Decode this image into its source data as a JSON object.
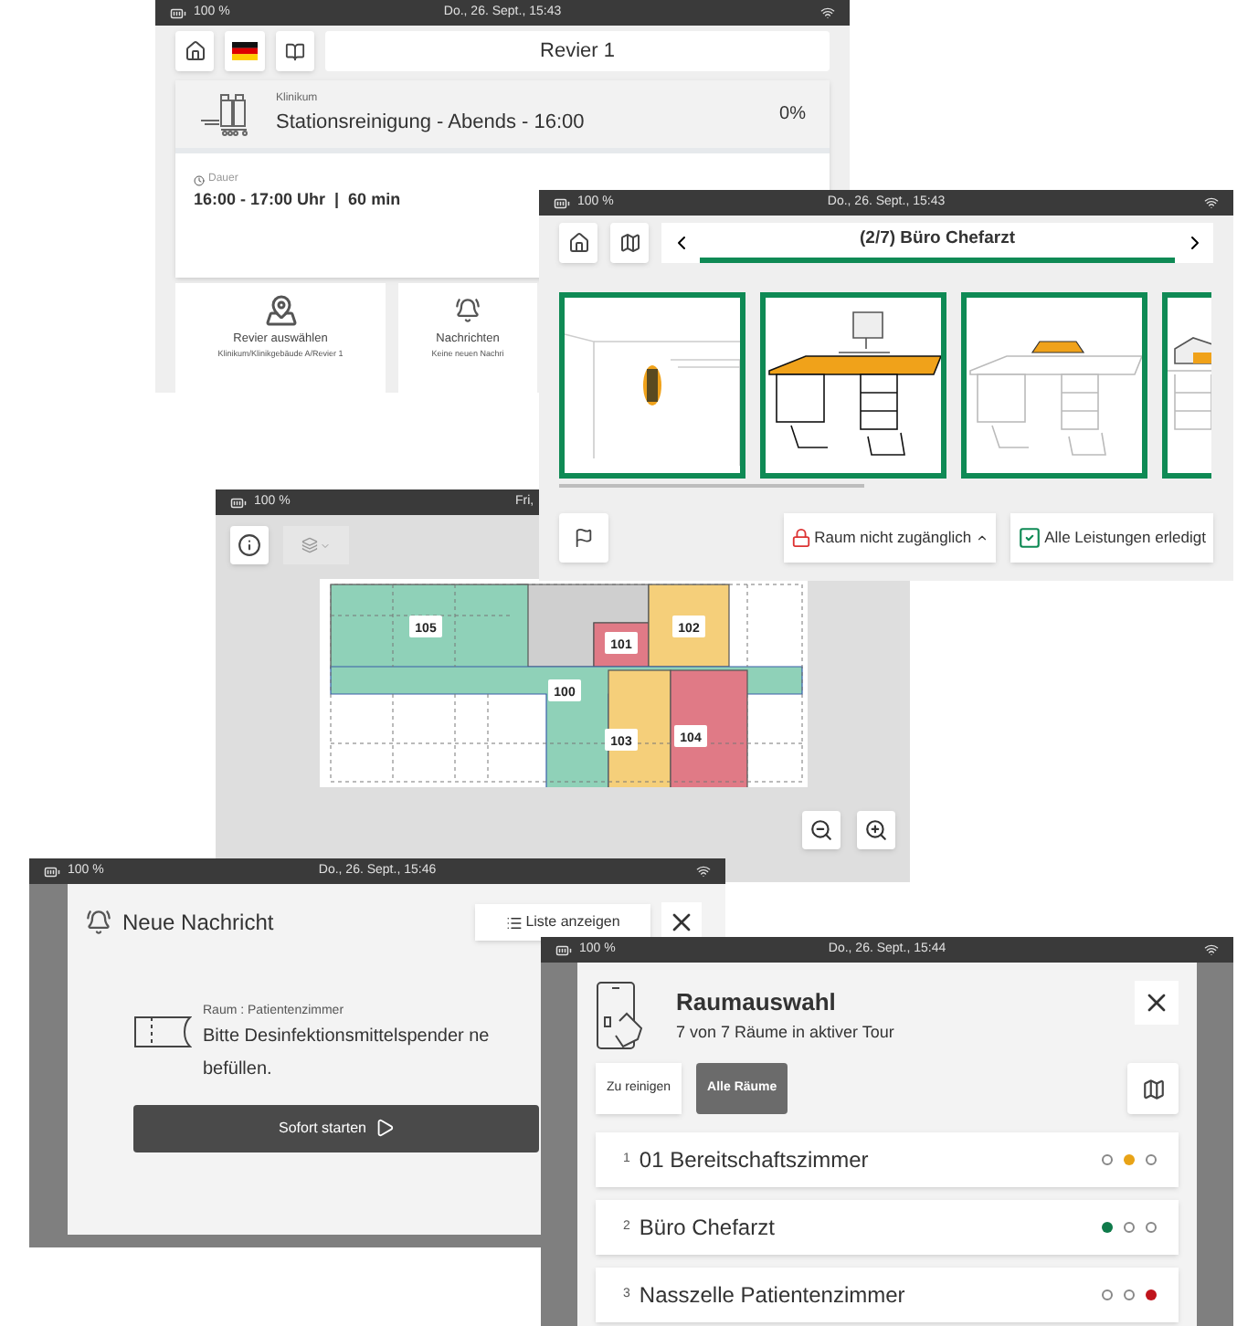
{
  "home_screen": {
    "status_bar": {
      "battery": "100 %",
      "datetime": "Do., 26. Sept., 15:43"
    },
    "title": "Revier 1",
    "tour": {
      "category": "Klinikum",
      "name": "Stationsreinigung - Abends - 16:00",
      "progress": "0%",
      "level": 0
    },
    "duration": {
      "label": "Dauer",
      "value": "16:00 - 17:00 Uhr  |  60 min"
    },
    "tiles": [
      {
        "title": "Revier auswählen",
        "subtitle": "Klinikum/Klinikgebäude A/Revier 1"
      },
      {
        "title": "Nachrichten",
        "subtitle": "Keine neuen Nachri"
      }
    ]
  },
  "room_screen": {
    "status_bar": {
      "battery": "100 %",
      "datetime": "Do., 26. Sept., 15:43"
    },
    "title": "(2/7) Büro Chefarzt",
    "buttons": [
      {
        "label": "Raum nicht zugänglich",
        "kind": "inaccessible"
      },
      {
        "label": "Alle Leistungen erledigt",
        "kind": "done"
      }
    ]
  },
  "map_screen": {
    "status_bar": {
      "battery": "100 %",
      "datetime": "Fri,"
    },
    "rooms": [
      {
        "number": "105",
        "color": "#8fd1b8"
      },
      {
        "number": "101",
        "color": "#e07a86"
      },
      {
        "number": "102",
        "color": "#f5cf7a"
      },
      {
        "number": "100",
        "color": "#8fd1b8"
      },
      {
        "number": "103",
        "color": "#f5cf7a"
      },
      {
        "number": "104",
        "color": "#e07a86"
      }
    ]
  },
  "message_screen": {
    "status_bar": {
      "battery": "100 %",
      "datetime": "Do., 26. Sept., 15:46"
    },
    "title": "Neue Nachricht",
    "list_button": "Liste anzeigen",
    "room": "Raum : Patientenzimmer",
    "message_lines": [
      "Bitte Desinfektionsmittelspender ne",
      "befüllen."
    ],
    "start_button": "Sofort starten"
  },
  "room_selection": {
    "status_bar": {
      "battery": "100 %",
      "datetime": "Do., 26. Sept., 15:44"
    },
    "title": "Raumauswahl",
    "subtitle": "7 von 7 Räume in aktiver Tour",
    "filters": [
      {
        "label": "Zu reinigen",
        "selected": false
      },
      {
        "label": "Alle Räume",
        "selected": true
      }
    ],
    "rooms": [
      {
        "number": "1",
        "name": "01 Bereitschaftszimmer",
        "status_dots": [
          {
            "filled": false
          },
          {
            "filled": true,
            "color": "#e8a317"
          },
          {
            "filled": false
          }
        ]
      },
      {
        "number": "2",
        "name": "Büro Chefarzt",
        "status_dots": [
          {
            "filled": true,
            "color": "#0f7a4a"
          },
          {
            "filled": false
          },
          {
            "filled": false
          }
        ]
      },
      {
        "number": "3",
        "name": "Nasszelle Patientenzimmer",
        "status_dots": [
          {
            "filled": false
          },
          {
            "filled": false
          },
          {
            "filled": true,
            "color": "#c0141c"
          }
        ]
      }
    ]
  }
}
